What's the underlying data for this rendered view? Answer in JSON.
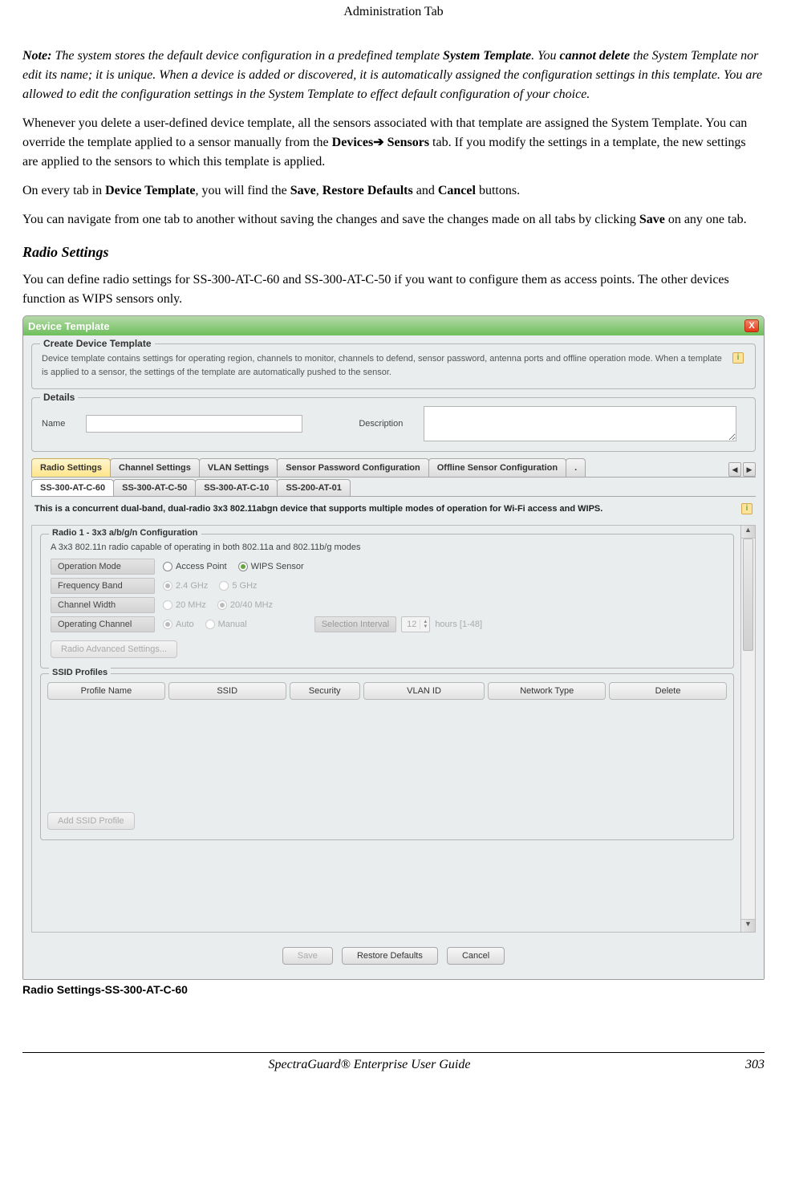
{
  "page": {
    "header": "Administration Tab",
    "footer_title": "SpectraGuard® Enterprise User Guide",
    "page_num": "303"
  },
  "note": {
    "prefix": "Note:",
    "t1": " The system stores the default device configuration in a predefined template ",
    "b1": "System Template",
    "t2": ". You ",
    "b2": "cannot delete",
    "t3": " the System Template nor edit its name; it is unique. When a device is added or discovered, it is automatically assigned the configuration settings in this template. You are allowed to edit the configuration settings in the System Template to effect default configuration of your choice."
  },
  "p1": {
    "t1": "Whenever you delete a user-defined device template, all the sensors associated with that template are assigned the System Template. You can override the template applied to a sensor manually from the ",
    "b1": "Devices",
    "arrow": "➔",
    "b2": " Sensors",
    "t2": " tab. If you modify the settings in a template, the new settings are applied to the sensors to which this template is applied."
  },
  "p2": {
    "t1": "On every tab in ",
    "b1": "Device Template",
    "t2": ", you will find the ",
    "b2": "Save",
    "t3": ", ",
    "b3": "Restore Defaults",
    "t4": " and ",
    "b4": "Cancel",
    "t5": " buttons."
  },
  "p3": {
    "t1": "You can navigate from one tab to another without saving the changes and save the changes made on all tabs by clicking ",
    "b1": "Save",
    "t2": " on any one tab."
  },
  "heading": "Radio Settings",
  "p4": "You can define radio settings for SS-300-AT-C-60 and SS-300-AT-C-50 if you want to configure them as access points. The other devices function as WIPS sensors only.",
  "caption": "Radio Settings-SS-300-AT-C-60",
  "dialog": {
    "title": "Device Template",
    "close_x": "X",
    "create": {
      "legend": "Create Device Template",
      "desc": "Device template contains settings for operating region, channels to monitor, channels to defend, sensor password, antenna ports and offline operation mode. When a template is applied to a sensor, the settings of the template are automatically pushed to the sensor.",
      "info": "i"
    },
    "details": {
      "legend": "Details",
      "name_lbl": "Name",
      "desc_lbl": "Description"
    },
    "tabs": [
      "Radio Settings",
      "Channel Settings",
      "VLAN Settings",
      "Sensor Password Configuration",
      "Offline Sensor Configuration"
    ],
    "tab_overflow": ".",
    "subtabs": [
      "SS-300-AT-C-60",
      "SS-300-AT-C-50",
      "SS-300-AT-C-10",
      "SS-200-AT-01"
    ],
    "device_desc": "This is a concurrent dual-band, dual-radio 3x3 802.11abgn device that supports multiple modes of operation for Wi-Fi access and WIPS.",
    "radio1": {
      "legend": "Radio 1 - 3x3 a/b/g/n Configuration",
      "sub": "A 3x3 802.11n radio capable of operating in both 802.11a and 802.11b/g modes",
      "rows": {
        "op_mode": {
          "label": "Operation Mode",
          "opt1": "Access Point",
          "opt2": "WIPS Sensor"
        },
        "freq": {
          "label": "Frequency Band",
          "opt1": "2.4 GHz",
          "opt2": "5 GHz"
        },
        "chw": {
          "label": "Channel Width",
          "opt1": "20 MHz",
          "opt2": "20/40 MHz"
        },
        "opch": {
          "label": "Operating Channel",
          "opt1": "Auto",
          "opt2": "Manual",
          "sel_lbl": "Selection Interval",
          "sel_val": "12",
          "hint": "hours [1-48]"
        }
      },
      "adv_btn": "Radio Advanced Settings..."
    },
    "ssid": {
      "legend": "SSID Profiles",
      "cols": [
        "Profile Name",
        "SSID",
        "Security",
        "VLAN ID",
        "Network Type",
        "Delete"
      ],
      "add_btn": "Add SSID Profile"
    },
    "buttons": {
      "save": "Save",
      "restore": "Restore Defaults",
      "cancel": "Cancel"
    }
  }
}
